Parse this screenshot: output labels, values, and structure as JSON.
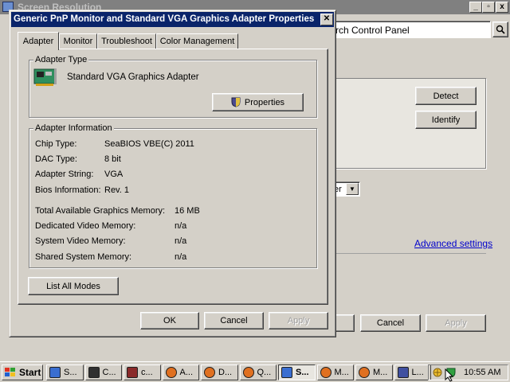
{
  "background_window": {
    "title": "Screen Resolution",
    "address_text": "rch Control Panel",
    "detect_label": "Detect",
    "identify_label": "Identify",
    "dropdown_partial": "er",
    "advanced_settings_label": "Advanced settings",
    "cancel_label": "Cancel",
    "apply_label": "Apply"
  },
  "dialog": {
    "title": "Generic PnP Monitor and Standard VGA Graphics Adapter Properties",
    "close_glyph": "✕",
    "tabs": [
      {
        "label": "Adapter"
      },
      {
        "label": "Monitor"
      },
      {
        "label": "Troubleshoot"
      },
      {
        "label": "Color Management"
      }
    ],
    "adapter_type": {
      "group_label": "Adapter Type",
      "name": "Standard VGA Graphics Adapter",
      "properties_label": "Properties"
    },
    "adapter_info": {
      "group_label": "Adapter Information",
      "rows": [
        {
          "label": "Chip Type:",
          "value": "SeaBIOS VBE(C) 2011"
        },
        {
          "label": "DAC Type:",
          "value": "8 bit"
        },
        {
          "label": "Adapter String:",
          "value": "VGA"
        },
        {
          "label": "Bios Information:",
          "value": "Rev. 1"
        }
      ],
      "memory": [
        {
          "label": "Total Available Graphics Memory:",
          "value": "16 MB"
        },
        {
          "label": "Dedicated Video Memory:",
          "value": "n/a"
        },
        {
          "label": "System Video Memory:",
          "value": "n/a"
        },
        {
          "label": "Shared System Memory:",
          "value": "n/a"
        }
      ]
    },
    "list_all_modes_label": "List All Modes",
    "ok_label": "OK",
    "cancel_label": "Cancel",
    "apply_label": "Apply"
  },
  "taskbar": {
    "start_label": "Start",
    "items": [
      {
        "label": "S...",
        "icon": "monitor-icon"
      },
      {
        "label": "C...",
        "icon": "console-icon"
      },
      {
        "label": "c...",
        "icon": "shield-icon"
      },
      {
        "label": "A...",
        "icon": "browser-icon"
      },
      {
        "label": "D...",
        "icon": "browser-icon"
      },
      {
        "label": "Q...",
        "icon": "browser-icon"
      },
      {
        "label": "S...",
        "icon": "monitor-icon"
      },
      {
        "label": "M...",
        "icon": "browser-icon"
      },
      {
        "label": "M...",
        "icon": "browser-icon"
      },
      {
        "label": "L...",
        "icon": "chart-icon"
      }
    ],
    "clock": "10:55 AM"
  },
  "colors": {
    "title_active": "#0a246a",
    "title_inactive": "#808080",
    "link": "#0000cc"
  }
}
